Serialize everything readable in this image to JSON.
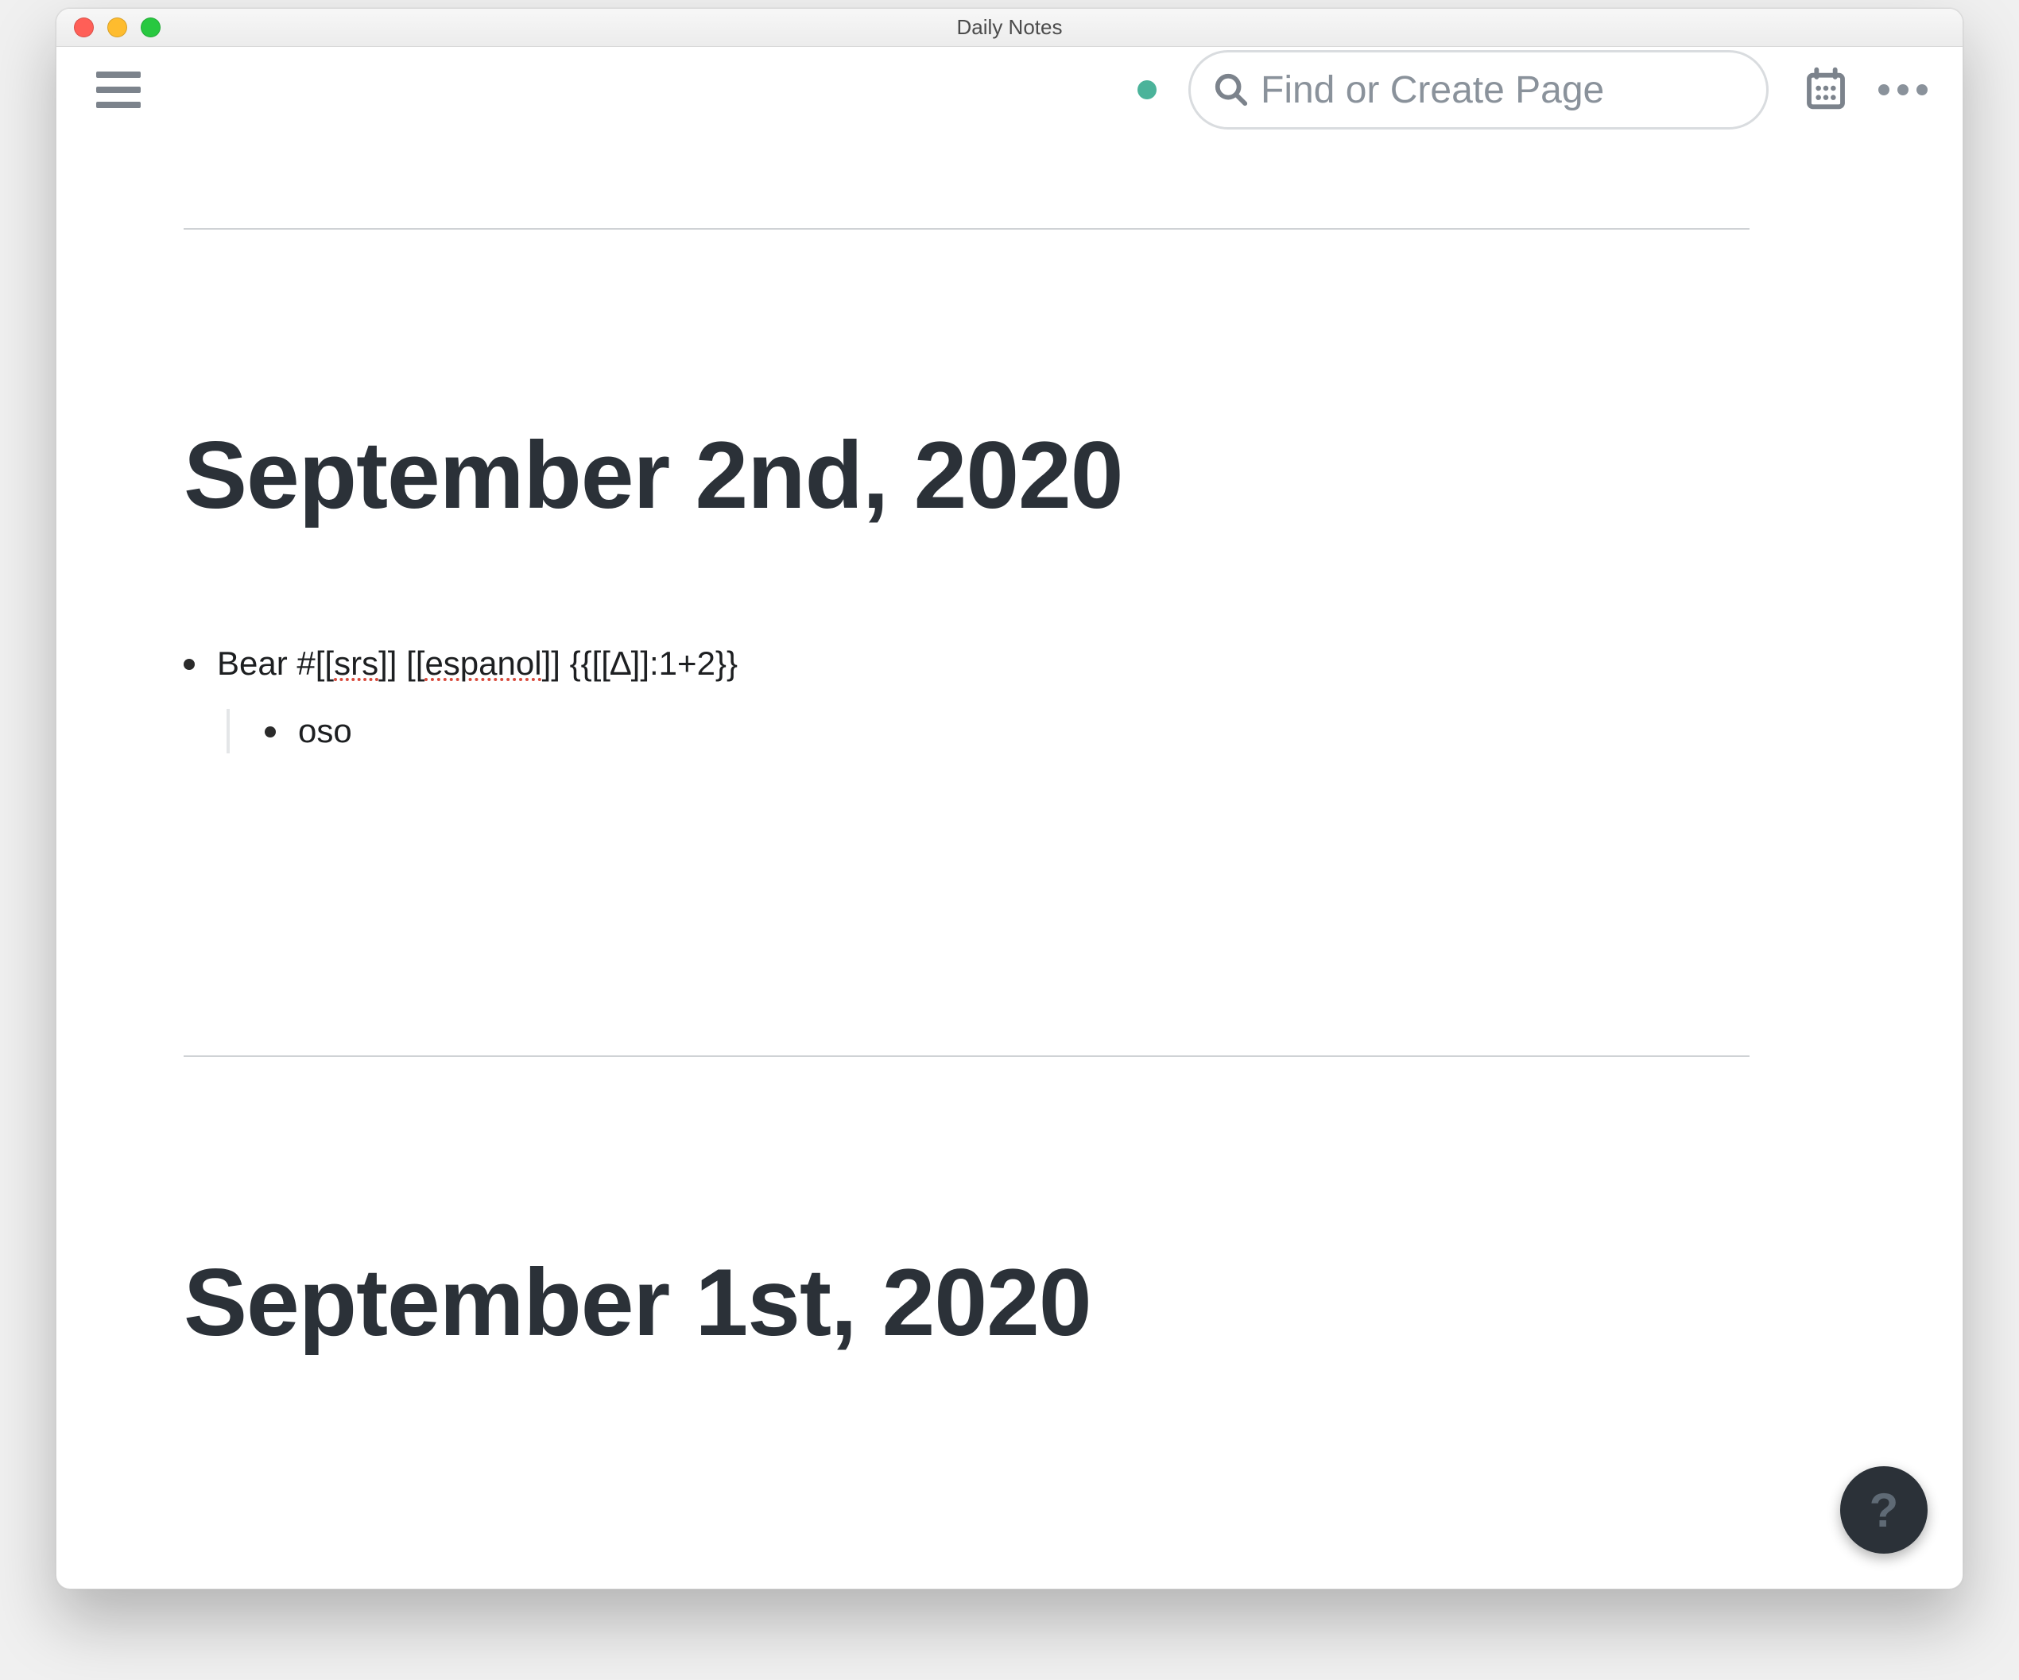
{
  "window": {
    "title": "Daily Notes"
  },
  "toolbar": {
    "search_placeholder": "Find or Create Page",
    "sync_color": "#4bb39a"
  },
  "notes": [
    {
      "title": "September 2nd, 2020",
      "blocks": [
        {
          "segments": [
            {
              "text": "Bear #[["
            },
            {
              "text": "srs",
              "spellerr": true
            },
            {
              "text": "]] [["
            },
            {
              "text": "espanol",
              "spellerr": true
            },
            {
              "text": "]] {{[[∆]]:1+2}}"
            }
          ],
          "children": [
            {
              "segments": [
                {
                  "text": "oso"
                }
              ]
            }
          ]
        }
      ]
    },
    {
      "title": "September 1st, 2020",
      "blocks": []
    }
  ],
  "help": {
    "label": "?"
  }
}
